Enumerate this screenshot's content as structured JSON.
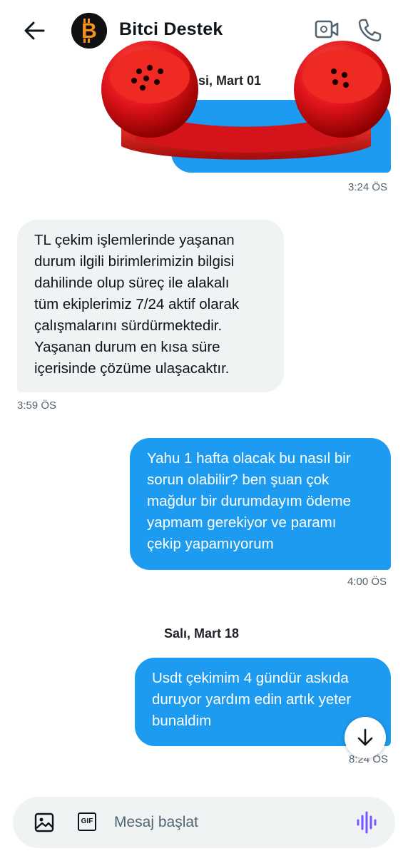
{
  "header": {
    "title": "Bitci Destek",
    "avatar_letter": "B",
    "icons": [
      "back-arrow-icon",
      "video-call-icon",
      "phone-call-icon"
    ]
  },
  "conversation": {
    "date_1": "si, Mart 01",
    "msg_1": {
      "time": "3:24 ÖS"
    },
    "msg_2": {
      "text": "TL çekim işlemlerinde yaşanan\ndurum ilgili birimlerimizin bilgisi\ndahilinde olup süreç ile alakalı\ntüm ekiplerimiz 7/24 aktif olarak\nçalışmalarını sürdürmektedir.\nYaşanan durum en kısa süre\niçerisinde çözüme ulaşacaktır.",
      "time": "3:59 ÖS"
    },
    "msg_3": {
      "text": "Yahu 1 hafta olacak bu nasıl bir\nsorun olabilir? ben şuan çok\nmağdur bir durumdayım ödeme\nyapmam gerekiyor ve paramı\nçekip yapamıyorum",
      "time": "4:00 ÖS"
    },
    "date_2": "Salı, Mart 18",
    "msg_4": {
      "text": "Usdt çekimim 4 gündür askıda\nduruyor yardım edin artık yeter\nbunaldim",
      "time": "8:24 ÖS"
    }
  },
  "composer": {
    "placeholder": "Mesaj başlat",
    "gif_label": "GIF",
    "icons": [
      "image-icon",
      "gif-icon",
      "voice-icon"
    ]
  },
  "colors": {
    "accent": "#1d9bf0",
    "incoming_bubble": "#eff3f4",
    "sticker_red": "#e0141b",
    "logo_orange": "#f7931a"
  }
}
